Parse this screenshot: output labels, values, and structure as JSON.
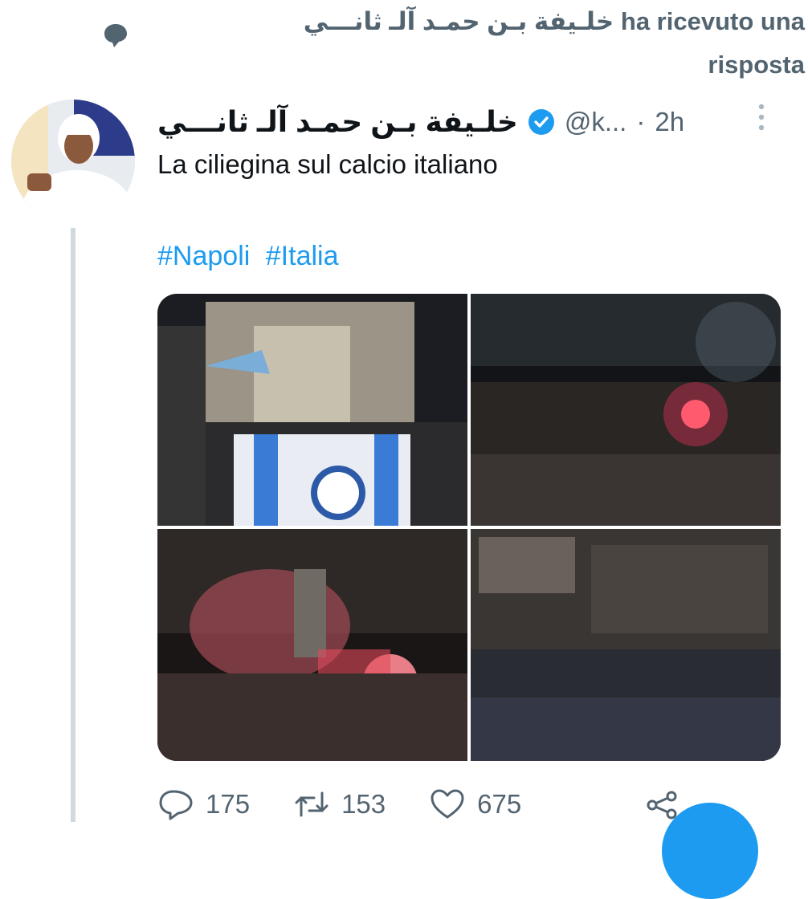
{
  "reply_header": {
    "text": "خلـيفة بـن حمـد آلـ ثانـــي ha ricevuto una risposta",
    "icon": "reply-bubble-icon"
  },
  "tweet": {
    "author": {
      "display_name": "خلـيفة بـن حمـد آلـ ثانـــي",
      "verified": true
    },
    "handle": "@k...",
    "separator": "·",
    "time": "2h",
    "text": "La ciliegina sul calcio italiano",
    "hashtags": [
      "#Napoli",
      "#Italia"
    ],
    "media": [
      {
        "icon": "photo-fans-flag-icon"
      },
      {
        "icon": "photo-crowd-flares-icon"
      },
      {
        "icon": "photo-statue-flares-icon"
      },
      {
        "icon": "photo-crowd-square-icon"
      }
    ],
    "actions": {
      "replies": "175",
      "retweets": "153",
      "likes": "675"
    }
  },
  "colors": {
    "accent": "#1d9bf0",
    "secondary_text": "#536471",
    "thread_line": "#cfd9de"
  }
}
